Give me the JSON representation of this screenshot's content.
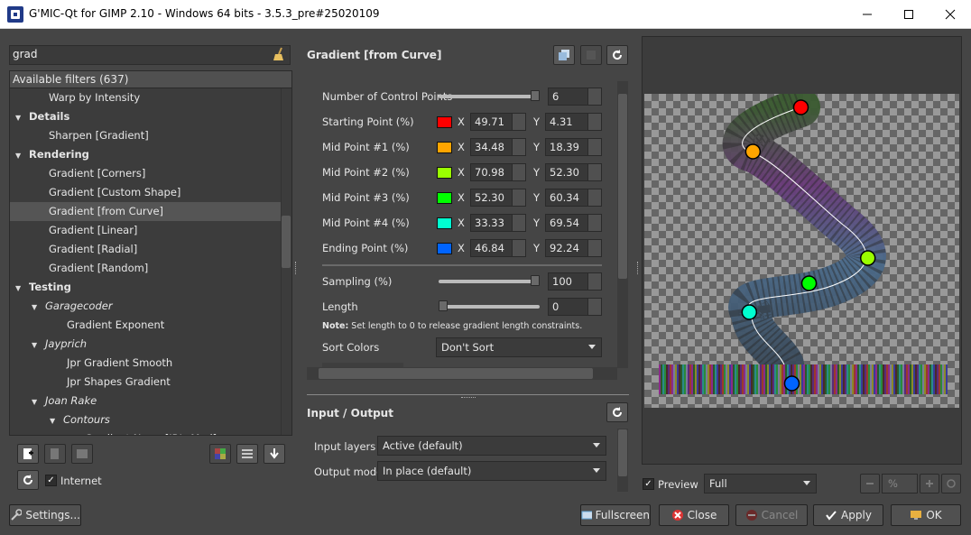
{
  "window": {
    "title": "G'MIC-Qt for GIMP 2.10 - Windows 64 bits - 3.5.3_pre#25020109",
    "minimize_icon": "minimize-icon",
    "maximize_icon": "maximize-icon",
    "close_icon": "close-icon"
  },
  "left": {
    "search_value": "grad",
    "tree_header": "Available filters (637)",
    "tree": [
      {
        "label": "Warp by Intensity",
        "level": 2,
        "type": "item"
      },
      {
        "label": "Details",
        "level": 0,
        "type": "folder"
      },
      {
        "label": "Sharpen [Gradient]",
        "level": 2,
        "type": "item"
      },
      {
        "label": "Rendering",
        "level": 0,
        "type": "folder"
      },
      {
        "label": "Gradient [Corners]",
        "level": 2,
        "type": "item"
      },
      {
        "label": "Gradient [Custom Shape]",
        "level": 2,
        "type": "item"
      },
      {
        "label": "Gradient [from Curve]",
        "level": 2,
        "type": "item",
        "selected": true
      },
      {
        "label": "Gradient [Linear]",
        "level": 2,
        "type": "item"
      },
      {
        "label": "Gradient [Radial]",
        "level": 2,
        "type": "item"
      },
      {
        "label": "Gradient [Random]",
        "level": 2,
        "type": "item"
      },
      {
        "label": "Testing",
        "level": 0,
        "type": "folder"
      },
      {
        "label": "Garagecoder",
        "level": 1,
        "type": "subfolder"
      },
      {
        "label": "Gradient Exponent",
        "level": 3,
        "type": "item"
      },
      {
        "label": "Jayprich",
        "level": 1,
        "type": "subfolder"
      },
      {
        "label": "Jpr Gradient Smooth",
        "level": 3,
        "type": "item"
      },
      {
        "label": "Jpr Shapes Gradient",
        "level": 3,
        "type": "item"
      },
      {
        "label": "Joan Rake",
        "level": 1,
        "type": "subfolder"
      },
      {
        "label": "Contours",
        "level": 2,
        "type": "subfolder2"
      },
      {
        "label": "Gradient Norm [JR's Mod]",
        "level": 4,
        "type": "item"
      }
    ],
    "internet_label": "Internet",
    "internet_checked": true
  },
  "filter": {
    "title": "Gradient [from Curve]",
    "num_points_label": "Number of Control Points",
    "num_points_value": "6",
    "num_points_fraction": 1.0,
    "points": [
      {
        "label": "Starting Point (%)",
        "color": "#ff0000",
        "x": "49.71",
        "y": "4.31"
      },
      {
        "label": "Mid Point #1 (%)",
        "color": "#ffa500",
        "x": "34.48",
        "y": "18.39"
      },
      {
        "label": "Mid Point #2 (%)",
        "color": "#9aff00",
        "x": "70.98",
        "y": "52.30"
      },
      {
        "label": "Mid Point #3 (%)",
        "color": "#00ff00",
        "x": "52.30",
        "y": "60.34"
      },
      {
        "label": "Mid Point #4 (%)",
        "color": "#00ffd0",
        "x": "33.33",
        "y": "69.54"
      },
      {
        "label": "Ending Point (%)",
        "color": "#0064ff",
        "x": "46.84",
        "y": "92.24"
      }
    ],
    "x_label": "X",
    "y_label": "Y",
    "sampling_label": "Sampling (%)",
    "sampling_value": "100",
    "sampling_fraction": 1.0,
    "length_label": "Length",
    "length_value": "0",
    "length_fraction": 0.0,
    "note_bold": "Note:",
    "note_text": "Set length to 0 to release gradient length constraints.",
    "sort_label": "Sort Colors",
    "sort_value": "Don't Sort"
  },
  "io": {
    "title": "Input / Output",
    "input_label": "Input layers",
    "input_value": "Active (default)",
    "output_label": "Output mode",
    "output_value": "In place (default)"
  },
  "preview": {
    "checkbox_label": "Preview",
    "checked": true,
    "mode_value": "Full",
    "zoom_value": "%"
  },
  "buttons": {
    "settings": "Settings...",
    "fullscreen": "Fullscreen",
    "close": "Close",
    "cancel": "Cancel",
    "apply": "Apply",
    "ok": "OK"
  },
  "colors": {
    "background": "#454545",
    "selection": "#555555"
  }
}
